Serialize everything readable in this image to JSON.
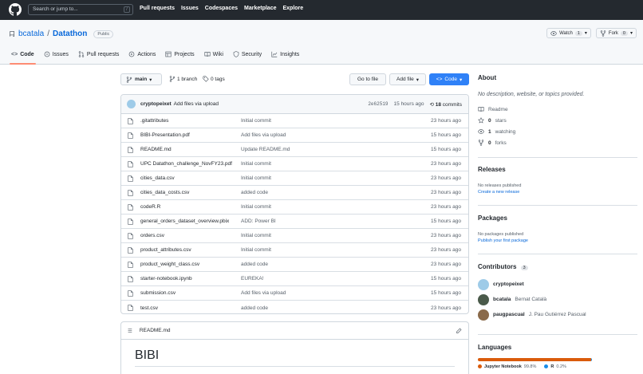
{
  "header": {
    "search_placeholder": "Search or jump to...",
    "search_key": "/",
    "nav": [
      "Pull requests",
      "Issues",
      "Codespaces",
      "Marketplace",
      "Explore"
    ]
  },
  "repo": {
    "owner": "bcatala",
    "separator": "/",
    "name": "Datathon",
    "visibility": "Public",
    "watch_label": "Watch",
    "watch_count": "1",
    "fork_label": "Fork",
    "fork_count": "0"
  },
  "tabs": [
    {
      "label": "Code",
      "icon": "code-icon",
      "active": true
    },
    {
      "label": "Issues",
      "icon": "issue-icon"
    },
    {
      "label": "Pull requests",
      "icon": "pull-request-icon"
    },
    {
      "label": "Actions",
      "icon": "play-icon"
    },
    {
      "label": "Projects",
      "icon": "table-icon"
    },
    {
      "label": "Wiki",
      "icon": "book-icon"
    },
    {
      "label": "Security",
      "icon": "shield-icon"
    },
    {
      "label": "Insights",
      "icon": "graph-icon"
    }
  ],
  "toolbar": {
    "branch": "main",
    "branches": "1 branch",
    "tags": "0 tags",
    "go_to_file": "Go to file",
    "add_file": "Add file",
    "code": "Code"
  },
  "commit": {
    "author": "cryptopeixet",
    "message": "Add files via upload",
    "sha": "2e62519",
    "time": "15 hours ago",
    "count": "18",
    "count_label": "commits"
  },
  "files": [
    {
      "name": ".gitattributes",
      "message": "Initial commit",
      "time": "23 hours ago"
    },
    {
      "name": "BIBI-Presentation.pdf",
      "message": "Add files via upload",
      "time": "15 hours ago"
    },
    {
      "name": "README.md",
      "message": "Update README.md",
      "time": "15 hours ago"
    },
    {
      "name": "UPC Datathon_challenge_NovFY23.pdf",
      "message": "Initial commit",
      "time": "23 hours ago"
    },
    {
      "name": "cities_data.csv",
      "message": "Initial commit",
      "time": "23 hours ago"
    },
    {
      "name": "cities_data_costs.csv",
      "message": "added code",
      "time": "23 hours ago"
    },
    {
      "name": "codeR.R",
      "message": "Initial commit",
      "time": "23 hours ago"
    },
    {
      "name": "general_orders_dataset_overview.pbix",
      "message": "ADD: Power BI",
      "time": "15 hours ago"
    },
    {
      "name": "orders.csv",
      "message": "Initial commit",
      "time": "23 hours ago"
    },
    {
      "name": "product_attributes.csv",
      "message": "Initial commit",
      "time": "23 hours ago"
    },
    {
      "name": "product_weight_class.csv",
      "message": "added code",
      "time": "23 hours ago"
    },
    {
      "name": "starter-notebook.ipynb",
      "message": "EUREKA!",
      "time": "15 hours ago"
    },
    {
      "name": "submission.csv",
      "message": "Add files via upload",
      "time": "15 hours ago"
    },
    {
      "name": "test.csv",
      "message": "added code",
      "time": "23 hours ago"
    }
  ],
  "readme": {
    "filename": "README.md",
    "heading": "BIBI"
  },
  "sidebar": {
    "about_title": "About",
    "about_desc": "No description, website, or topics provided.",
    "about_items": [
      {
        "icon": "book-icon",
        "value": "",
        "label": "Readme"
      },
      {
        "icon": "star-icon",
        "value": "0",
        "label": "stars"
      },
      {
        "icon": "eye-icon",
        "value": "1",
        "label": "watching"
      },
      {
        "icon": "fork-icon",
        "value": "0",
        "label": "forks"
      }
    ],
    "releases_title": "Releases",
    "releases_none": "No releases published",
    "releases_link": "Create a new release",
    "packages_title": "Packages",
    "packages_none": "No packages published",
    "packages_link": "Publish your first package",
    "contributors_title": "Contributors",
    "contributors_count": "3",
    "contributors": [
      {
        "login": "cryptopeixet",
        "full": "",
        "color": "#9ecbe8"
      },
      {
        "login": "bcatala",
        "full": "Bernat Català",
        "color": "#4a5a4a"
      },
      {
        "login": "paugpascual",
        "full": "J. Pau Gutiérrez Pascual",
        "color": "#8a6a4a"
      }
    ],
    "languages_title": "Languages",
    "languages": [
      {
        "name": "Jupyter Notebook",
        "percent": "99.8%",
        "share": 99.8,
        "color": "#DA5B0B"
      },
      {
        "name": "R",
        "percent": "0.2%",
        "share": 0.2,
        "color": "#198CE7"
      }
    ]
  },
  "colors": {
    "accent": "#0969da",
    "primary_button": "#2f81f7",
    "header_bg": "#24292f"
  }
}
